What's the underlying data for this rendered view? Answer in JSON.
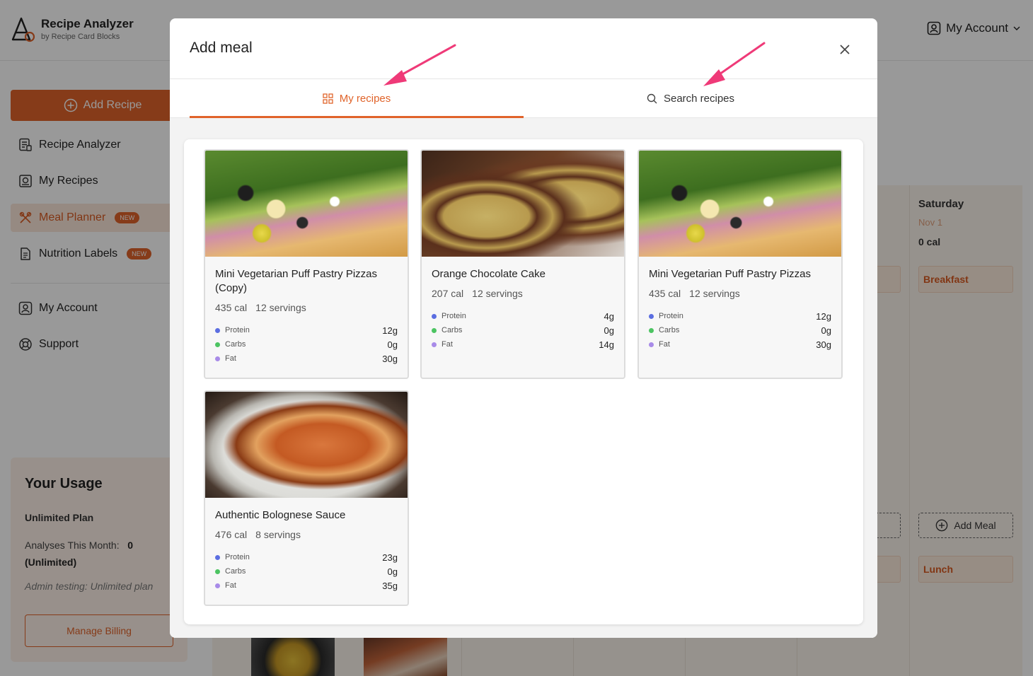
{
  "app": {
    "title": "Recipe Analyzer",
    "subtitle": "by Recipe Card Blocks",
    "account_label": "My Account"
  },
  "sidebar": {
    "add_recipe_label": "Add Recipe",
    "items": [
      {
        "label": "Recipe Analyzer",
        "icon": "calculator-icon"
      },
      {
        "label": "My Recipes",
        "icon": "book-icon"
      },
      {
        "label": "Meal Planner",
        "icon": "utensils-icon",
        "badge": "NEW",
        "active": true
      },
      {
        "label": "Nutrition Labels",
        "icon": "document-icon",
        "badge": "NEW"
      },
      {
        "label": "My Account",
        "icon": "user-icon"
      },
      {
        "label": "Support",
        "icon": "lifebuoy-icon"
      }
    ],
    "usage": {
      "title": "Your Usage",
      "plan": "Unlimited Plan",
      "analyses_label": "Analyses This Month:",
      "analyses_value": "0",
      "analyses_note": "(Unlimited)",
      "admin_note": "Admin testing: Unlimited plan",
      "billing_label": "Manage Billing"
    }
  },
  "planner": {
    "saturday": {
      "day": "Saturday",
      "date": "Nov 1",
      "cal": "0 cal"
    },
    "breakfast_label": "Breakfast",
    "lunch_label": "Lunch",
    "add_meal_label": "Add Meal"
  },
  "modal": {
    "title": "Add meal",
    "tabs": [
      {
        "label": "My recipes",
        "icon": "grid-icon",
        "active": true
      },
      {
        "label": "Search recipes",
        "icon": "search-icon",
        "active": false
      }
    ],
    "recipes": [
      {
        "name": "Mini Vegetarian Puff Pastry Pizzas (Copy)",
        "cal": "435 cal",
        "servings": "12 servings",
        "image": "pizza",
        "protein": "12g",
        "carbs": "0g",
        "fat": "30g"
      },
      {
        "name": "Orange Chocolate Cake",
        "cal": "207 cal",
        "servings": "12 servings",
        "image": "cake",
        "protein": "4g",
        "carbs": "0g",
        "fat": "14g"
      },
      {
        "name": "Mini Vegetarian Puff Pastry Pizzas",
        "cal": "435 cal",
        "servings": "12 servings",
        "image": "pizza",
        "protein": "12g",
        "carbs": "0g",
        "fat": "30g"
      },
      {
        "name": "Authentic Bolognese Sauce",
        "cal": "476 cal",
        "servings": "8 servings",
        "image": "pasta",
        "protein": "23g",
        "carbs": "0g",
        "fat": "35g"
      }
    ],
    "macro_labels": {
      "protein": "Protein",
      "carbs": "Carbs",
      "fat": "Fat"
    }
  },
  "colors": {
    "accent": "#e0632a",
    "protein_dot": "#5b6ee1",
    "carbs_dot": "#4cc462",
    "fat_dot": "#a88be8",
    "arrow": "#ef3a78"
  }
}
